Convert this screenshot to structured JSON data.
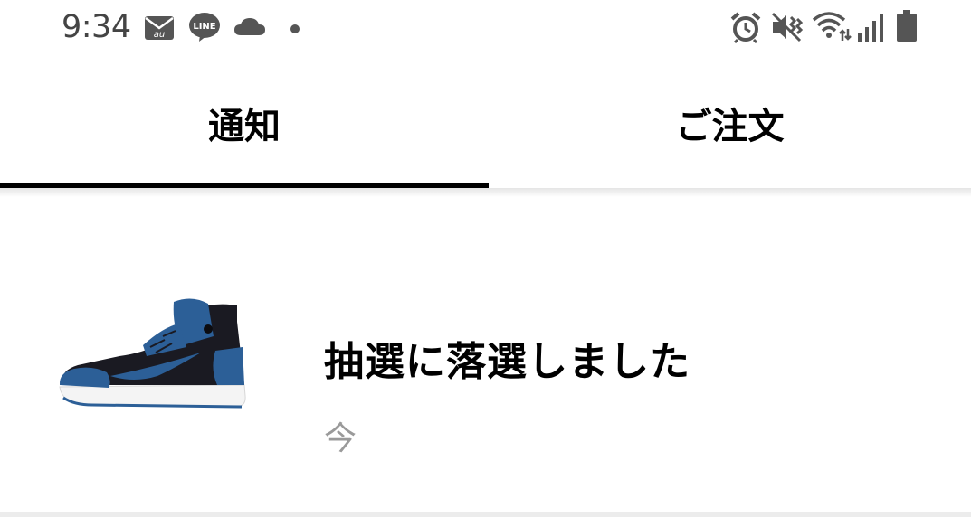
{
  "status_bar": {
    "time": "9:34",
    "notification_icons": [
      "mail-icon",
      "line-icon",
      "cloud-icon",
      "dot-icon"
    ],
    "system_icons": [
      "alarm-icon",
      "mute-icon",
      "wifi-icon",
      "signal-icon",
      "battery-icon"
    ],
    "mail_badge": "au",
    "line_label": "LINE"
  },
  "tabs": [
    {
      "label": "通知",
      "selected": true
    },
    {
      "label": "ご注文",
      "selected": false
    }
  ],
  "notifications": [
    {
      "title": "抽選に落選しました",
      "time": "今",
      "thumbnail": "sneaker-image"
    }
  ],
  "colors": {
    "text": "#000000",
    "muted": "#9a9a9a",
    "status_icons": "#555555",
    "indicator": "#000000",
    "sneaker_blue": "#2c5f97",
    "sneaker_black": "#1a1a22"
  }
}
